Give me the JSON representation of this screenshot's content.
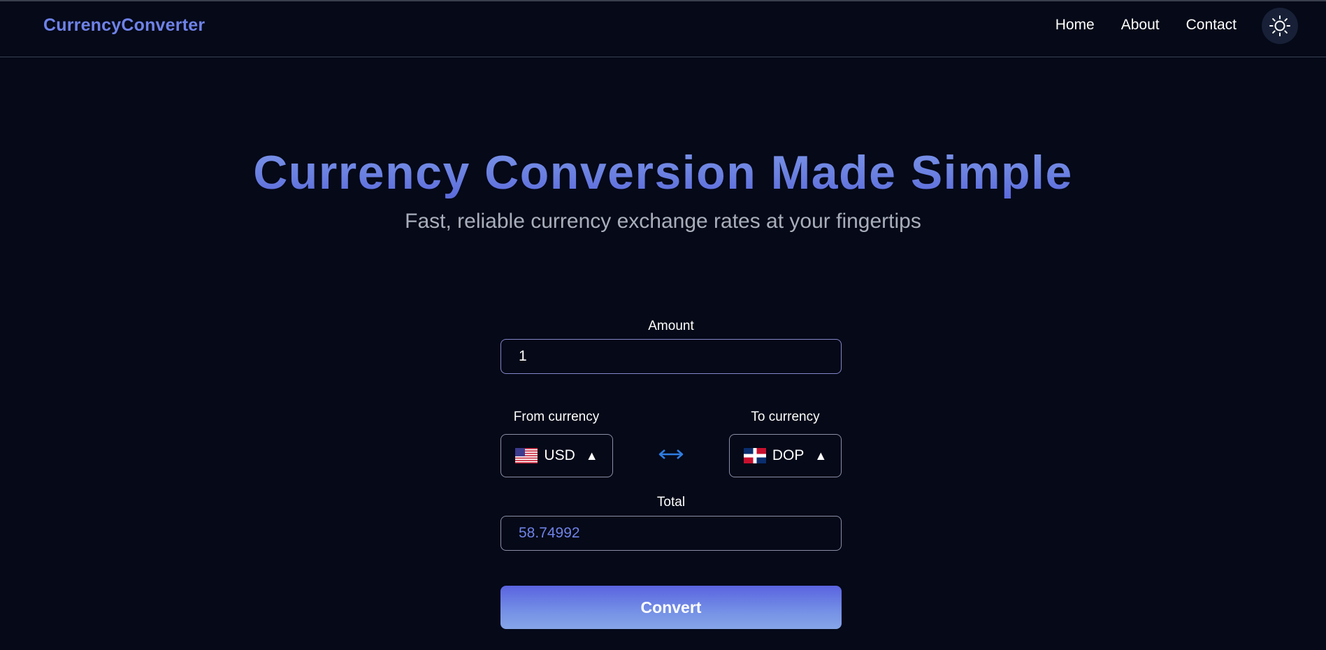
{
  "brand": "CurrencyConverter",
  "nav": {
    "items": [
      {
        "label": "Home"
      },
      {
        "label": "About"
      },
      {
        "label": "Contact"
      }
    ],
    "theme_icon": "sun-icon"
  },
  "hero": {
    "title": "Currency Conversion Made Simple",
    "subtitle": "Fast, reliable currency exchange rates at your fingertips"
  },
  "form": {
    "amount_label": "Amount",
    "amount_value": "1",
    "from_label": "From currency",
    "from_currency": "USD",
    "from_flag": "us-flag-icon",
    "to_label": "To currency",
    "to_currency": "DOP",
    "to_flag": "do-flag-icon",
    "caret": "▲",
    "swap_icon": "swap-arrows-icon",
    "total_label": "Total",
    "total_value": "58.74992",
    "convert_label": "Convert"
  },
  "colors": {
    "background": "#050918",
    "brand": "#6f82e8",
    "accent": "#2f7de1",
    "button_top": "#5a63e0",
    "button_bottom": "#86a5e8"
  }
}
